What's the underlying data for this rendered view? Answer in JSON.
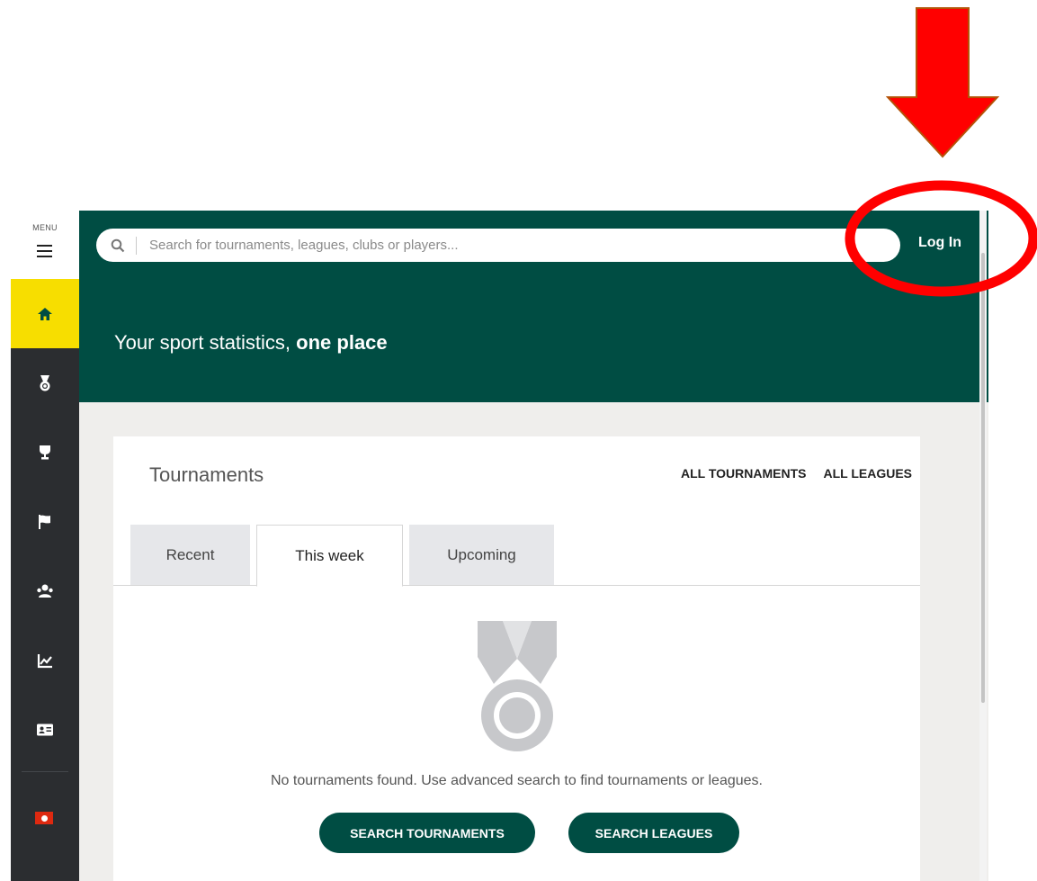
{
  "sidebar": {
    "menu_label": "MENU",
    "items": [
      {
        "icon": "home-icon",
        "active": true
      },
      {
        "icon": "medal-icon",
        "active": false
      },
      {
        "icon": "trophy-icon",
        "active": false
      },
      {
        "icon": "flag-icon",
        "active": false
      },
      {
        "icon": "players-icon",
        "active": false
      },
      {
        "icon": "stats-chart-icon",
        "active": false
      },
      {
        "icon": "id-card-icon",
        "active": false
      }
    ],
    "region_flag": "hong-kong-flag-icon"
  },
  "header": {
    "search_placeholder": "Search for tournaments, leagues, clubs or players...",
    "login_label": "Log In",
    "tagline_prefix": "Your sport statistics, ",
    "tagline_bold": "one place"
  },
  "tournaments": {
    "title": "Tournaments",
    "links": {
      "all_tournaments": "ALL TOURNAMENTS",
      "all_leagues": "ALL LEAGUES"
    },
    "tabs": [
      {
        "label": "Recent",
        "active": false
      },
      {
        "label": "This week",
        "active": true
      },
      {
        "label": "Upcoming",
        "active": false
      }
    ],
    "empty_message": "No tournaments found. Use advanced search to find tournaments or leagues.",
    "buttons": {
      "search_tournaments": "SEARCH TOURNAMENTS",
      "search_leagues": "SEARCH LEAGUES"
    }
  },
  "colors": {
    "header_bg": "#004d43",
    "sidebar_bg": "#2b2d30",
    "active_accent": "#f7de00",
    "annotation_red": "#ff0000"
  }
}
